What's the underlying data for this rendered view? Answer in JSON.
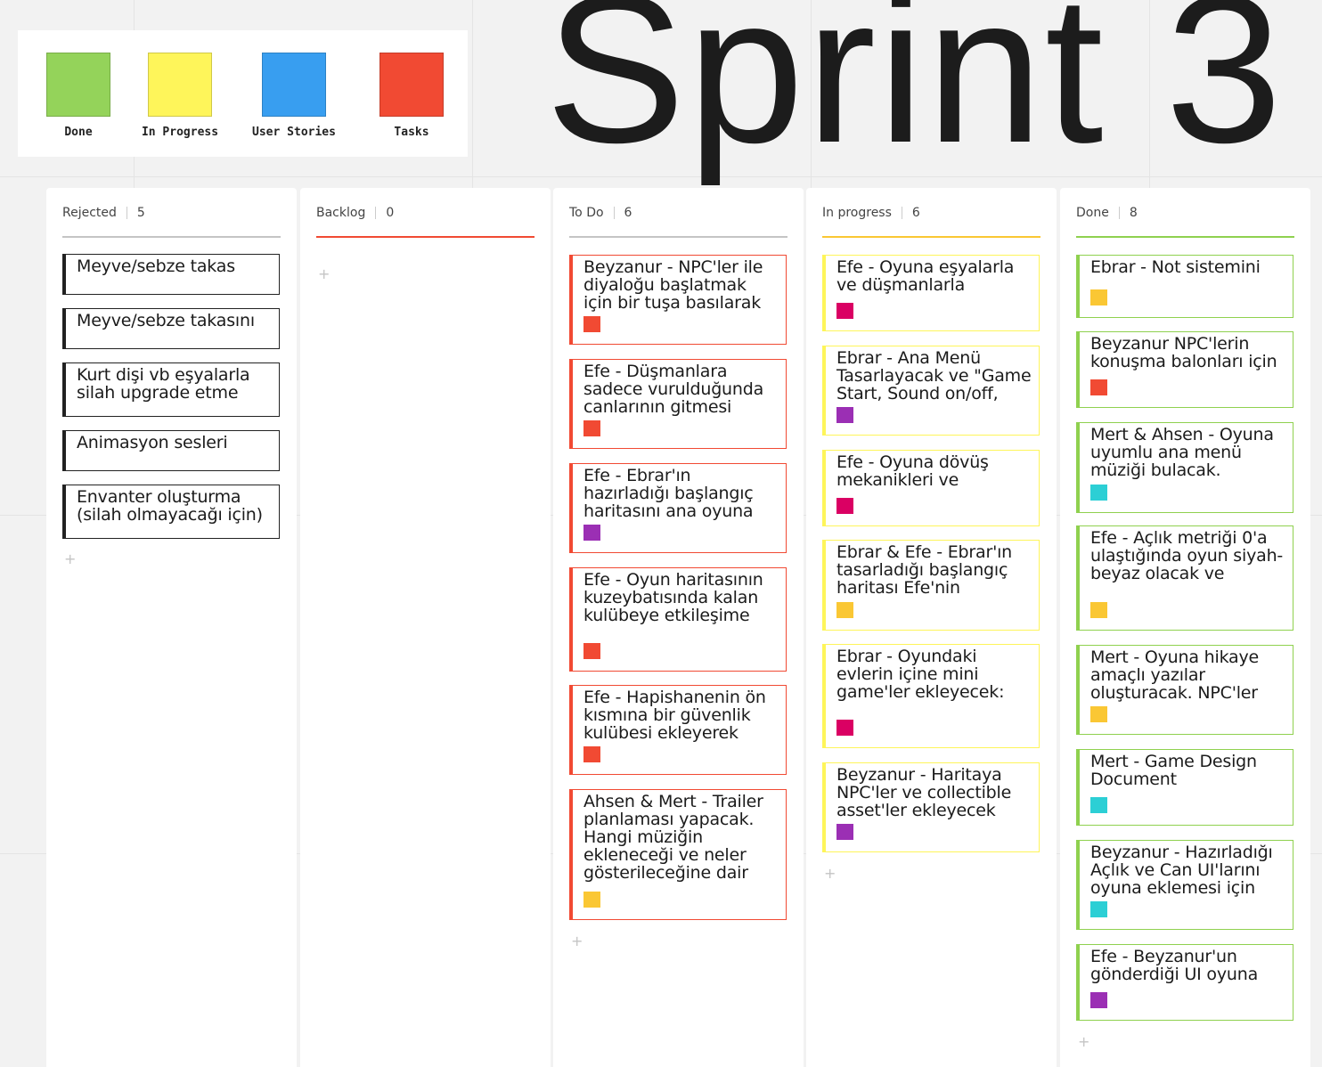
{
  "legend": [
    {
      "label": "Done",
      "color": "#94d35a"
    },
    {
      "label": "In Progress",
      "color": "#fef55a"
    },
    {
      "label": "User Stories",
      "color": "#389ef0"
    },
    {
      "label": "Tasks",
      "color": "#f14a33"
    }
  ],
  "title": "Sprint 3",
  "add_symbol": "+",
  "columns": [
    {
      "name": "Rejected",
      "count": "5",
      "rule_color": "#c4c4c4",
      "card_border": "#222222",
      "cards": [
        {
          "text": "Meyve/sebze takas"
        },
        {
          "text": "Meyve/sebze takasını"
        },
        {
          "text": "Kurt dişi vb eşyalarla silah upgrade etme"
        },
        {
          "text": "Animasyon sesleri"
        },
        {
          "text": "Envanter oluşturma (silah olmayacağı için)"
        }
      ]
    },
    {
      "name": "Backlog",
      "count": "0",
      "rule_color": "#f14a33",
      "card_border": "#f14a33",
      "cards": []
    },
    {
      "name": "To Do",
      "count": "6",
      "rule_color": "#c4c4c4",
      "card_border": "#f14a33",
      "cards": [
        {
          "text": "Beyzanur - NPC'ler ile diyaloğu başlatmak için bir tuşa basılarak",
          "tag": "#f14a33"
        },
        {
          "text": "Efe - Düşmanlara sadece vurulduğunda canlarının gitmesi",
          "tag": "#f14a33"
        },
        {
          "text": "Efe - Ebrar'ın hazırladığı başlangıç haritasını ana oyuna",
          "tag": "#9b2fb4"
        },
        {
          "text": "Efe - Oyun haritasının kuzeybatısında kalan kulübeye etkileşime",
          "tag": "#f14a33"
        },
        {
          "text": "Efe - Hapishanenin ön kısmına bir güvenlik kulübesi ekleyerek",
          "tag": "#f14a33"
        },
        {
          "text": "Ahsen & Mert - Trailer planlaması yapacak. Hangi müziğin ekleneceği ve neler gösterileceğine dair",
          "tag": "#fac734"
        }
      ]
    },
    {
      "name": "In progress",
      "count": "6",
      "rule_color": "#fac734",
      "card_border": "#fef55a",
      "cards": [
        {
          "text": "Efe - Oyuna eşyalarla ve düşmanlarla",
          "tag": "#da0063"
        },
        {
          "text": "Ebrar - Ana Menü Tasarlayacak ve \"Game Start, Sound on/off,",
          "tag": "#9b2fb4"
        },
        {
          "text": "Efe - Oyuna dövüş mekanikleri ve",
          "tag": "#da0063"
        },
        {
          "text": "Ebrar & Efe - Ebrar'ın tasarladığı başlangıç haritası Efe'nin",
          "tag": "#fac734"
        },
        {
          "text": "Ebrar - Oyundaki evlerin içine mini game'ler ekleyecek:",
          "tag": "#da0063"
        },
        {
          "text": "Beyzanur - Haritaya NPC'ler ve collectible asset'ler ekleyecek",
          "tag": "#9b2fb4"
        }
      ]
    },
    {
      "name": "Done",
      "count": "8",
      "rule_color": "#8fd14f",
      "card_border": "#8fd14f",
      "cards": [
        {
          "text": "Ebrar - Not sistemini",
          "tag": "#fac734"
        },
        {
          "text": "Beyzanur NPC'lerin konuşma balonları için",
          "tag": "#f14a33"
        },
        {
          "text": "Mert & Ahsen - Oyuna uyumlu ana menü müziği bulacak.",
          "tag": "#2ccfd5"
        },
        {
          "text": "Efe - Açlık metriği 0'a ulaştığında oyun siyah-beyaz olacak ve",
          "tag": "#fac734"
        },
        {
          "text": "Mert - Oyuna hikaye amaçlı yazılar oluşturacak. NPC'ler",
          "tag": "#fac734"
        },
        {
          "text": "Mert - Game Design Document",
          "tag": "#2ccfd5"
        },
        {
          "text": "Beyzanur - Hazırladığı Açlık ve Can UI'larını oyuna eklemesi için",
          "tag": "#2ccfd5"
        },
        {
          "text": "Efe - Beyzanur'un gönderdiği UI oyuna",
          "tag": "#9b2fb4"
        }
      ]
    }
  ]
}
